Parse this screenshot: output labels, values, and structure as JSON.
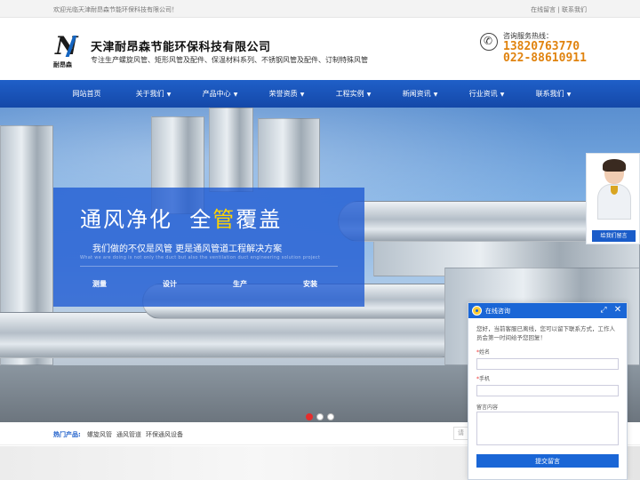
{
  "topbar": {
    "welcome": "欢迎光临天津耐昂森节能环保科技有限公司！",
    "link_message": "在线留言",
    "separator": "|",
    "link_contact": "联系我们"
  },
  "header": {
    "logo_glyph": "N",
    "logo_sub": "耐昂森",
    "company_name": "天津耐昂森节能环保科技有限公司",
    "slogan": "专注生产螺旋风管、矩形风管及配件、保温材料系列、不锈钢风管及配件、订制特殊风管",
    "hotline_label": "咨询服务热线：",
    "hotline_1": "13820763770",
    "hotline_2": "022-88610911"
  },
  "nav": {
    "items": [
      {
        "label": "网站首页",
        "caret": ""
      },
      {
        "label": "关于我们",
        "caret": "▼"
      },
      {
        "label": "产品中心",
        "caret": "▼"
      },
      {
        "label": "荣誉资质",
        "caret": "▼"
      },
      {
        "label": "工程实例",
        "caret": "▼"
      },
      {
        "label": "新闻资讯",
        "caret": "▼"
      },
      {
        "label": "行业资讯",
        "caret": "▼"
      },
      {
        "label": "联系我们",
        "caret": "▼"
      }
    ]
  },
  "banner": {
    "title_a": "通风净化",
    "title_b": "全",
    "title_hl": "管",
    "title_c": "覆盖",
    "subtitle": "我们做的不仅是风管  更是通风管道工程解决方案",
    "subtitle_en": "What we are doing is not only the duct but also the ventilation duct engineering solution project",
    "pills": [
      "测量",
      "设计",
      "生产",
      "安装"
    ],
    "slides": 3,
    "active_slide": 1
  },
  "hot": {
    "label": "热门产品:",
    "items": [
      "螺旋风管",
      "通风管道",
      "环保通风设备"
    ],
    "search_stub": "请"
  },
  "service_card": {
    "button": "给我们留言"
  },
  "chat": {
    "title": "在线咨询",
    "minimize": "⤢",
    "close": "✕",
    "message": "您好，当前客服已离线，您可以留下联系方式，工作人员会第一时间给予您回复！",
    "name_label": "姓名",
    "phone_label": "手机",
    "comment_label": "留言内容",
    "required_mark": "*",
    "submit": "提交留言"
  },
  "colors": {
    "brand_blue": "#1a5cc9",
    "hotline_orange": "#e0830f",
    "highlight_yellow": "#ffd400",
    "active_dot": "#e52d2d"
  }
}
